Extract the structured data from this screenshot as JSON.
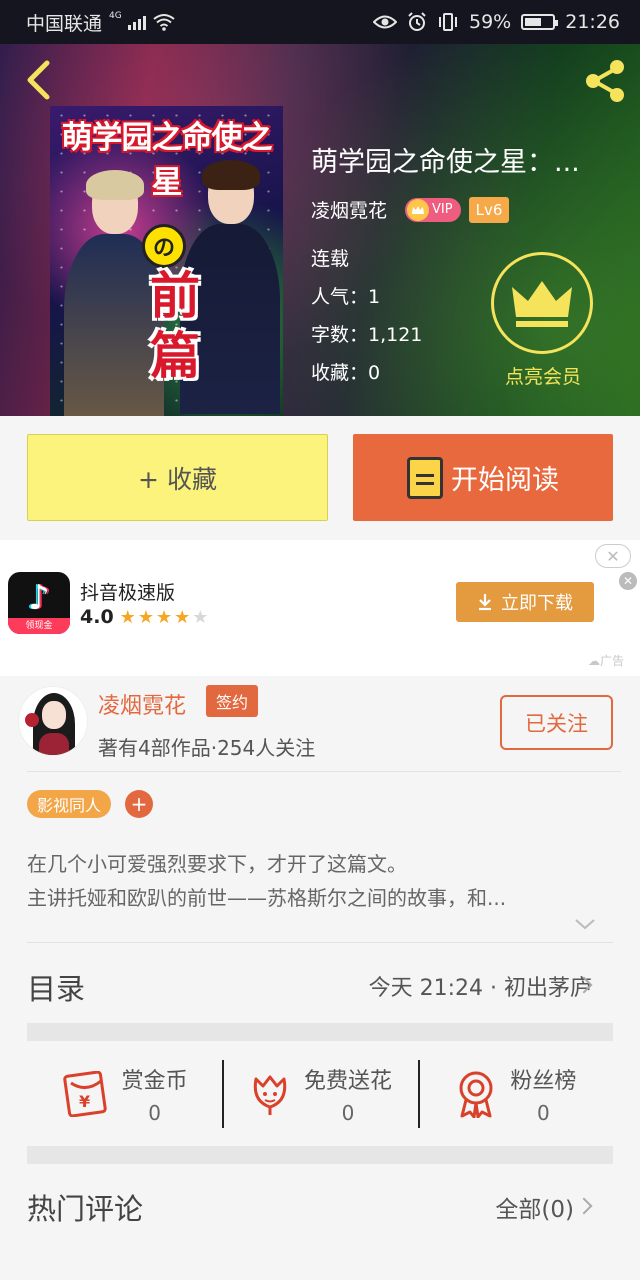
{
  "status_bar": {
    "carrier": "中国联通",
    "network": "4G",
    "battery": "59%",
    "battery_level": 0.59,
    "time": "21:26"
  },
  "book": {
    "title": "萌学园之命使之星：...",
    "cover_title": "萌学园之命使之星",
    "cover_badge": "の",
    "cover_big_1": "前",
    "cover_big_2": "篇",
    "author": "凌烟霓花",
    "vip_label": "VIP",
    "level": "Lv6",
    "status": "连载",
    "popularity": "人气：1",
    "word_count": "字数：1,121",
    "favorites": "收藏：0",
    "member_label": "点亮会员"
  },
  "actions": {
    "favorite_label": "+ 收藏",
    "read_label": "开始阅读"
  },
  "ad": {
    "app_name": "抖音极速版",
    "rating": "4.0",
    "stars_filled": 4,
    "stars_total": 5,
    "icon_ribbon": "领现金",
    "download_label": "立即下载",
    "ad_tag": "广告"
  },
  "author_section": {
    "name": "凌烟霓花",
    "sign_badge": "签约",
    "meta": "著有4部作品·254人关注",
    "follow_label": "已关注"
  },
  "tags": {
    "primary": "影视同人",
    "add": "+"
  },
  "description": {
    "line1": "在几个小可爱强烈要求下，才开了这篇文。",
    "line2": "主讲托娅和欧趴的前世——苏格斯尔之间的故事，和..."
  },
  "toc": {
    "title": "目录",
    "latest": "今天 21:24 · 初出茅庐"
  },
  "rewards": [
    {
      "label": "赏金币",
      "count": "0",
      "icon": "red-envelope-icon"
    },
    {
      "label": "免费送花",
      "count": "0",
      "icon": "flower-icon"
    },
    {
      "label": "粉丝榜",
      "count": "0",
      "icon": "medal-icon"
    }
  ],
  "comments": {
    "title": "热门评论",
    "all_label": "全部(0)"
  },
  "colors": {
    "accent": "#e8693d",
    "favorite_bg": "#fbf37c",
    "member_gold": "#f5e35c",
    "tag_orange": "#f3a648"
  }
}
